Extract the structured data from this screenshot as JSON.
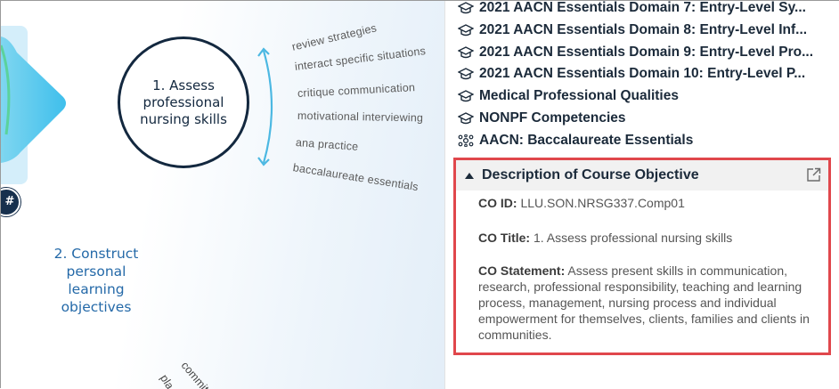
{
  "map": {
    "main_node": "1. Assess professional nursing skills",
    "hash_badge": "#",
    "leaves": [
      "review strategies",
      "interact specific situations",
      "critique communication",
      "motivational interviewing",
      "ana practice",
      "baccalaureate essentials"
    ],
    "node2": "2. Construct personal learning objectives",
    "bottom_leaves": [
      "commit",
      "pla"
    ]
  },
  "panel": {
    "list": [
      {
        "label": "2021 AACN Essentials Domain 7: Entry-Level Sy...",
        "icon": "graduation-cap-icon"
      },
      {
        "label": "2021 AACN Essentials Domain 8: Entry-Level Inf...",
        "icon": "graduation-cap-icon"
      },
      {
        "label": "2021 AACN Essentials Domain 9: Entry-Level Pro...",
        "icon": "graduation-cap-icon"
      },
      {
        "label": "2021 AACN Essentials Domain 10: Entry-Level P...",
        "icon": "graduation-cap-icon"
      },
      {
        "label": "Medical Professional Qualities",
        "icon": "graduation-cap-icon"
      },
      {
        "label": "NONPF Competencies",
        "icon": "graduation-cap-icon"
      },
      {
        "label": "AACN: Baccalaureate Essentials",
        "icon": "network-icon"
      }
    ],
    "description": {
      "title": "Description of Course Objective",
      "co_id_label": "CO ID:",
      "co_id_value": "LLU.SON.NRSG337.Comp01",
      "co_title_label": "CO Title:",
      "co_title_value": "1. Assess professional nursing skills",
      "co_statement_label": "CO Statement:",
      "co_statement_value": "Assess present skills in communication, research, professional responsibility, teaching and learning process, management, nursing process and individual empowerment for themselves, clients, families and clients in communities."
    }
  }
}
